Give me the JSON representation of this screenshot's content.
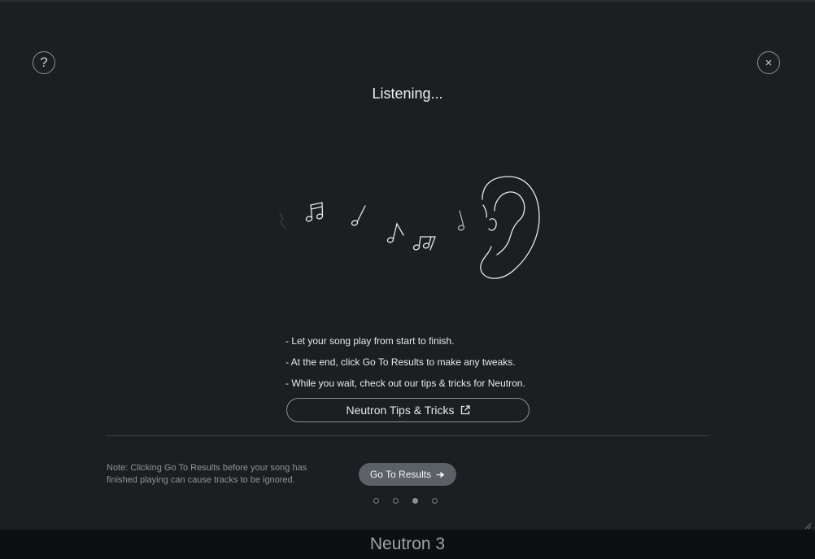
{
  "header": {
    "title": "Listening...",
    "help_icon": "question-mark-icon",
    "close_icon": "close-icon"
  },
  "instructions": [
    "- Let your song play from start to finish.",
    "- At the end, click Go To Results to make any tweaks.",
    "- While you wait, check out our tips & tricks for Neutron."
  ],
  "tips_button": {
    "label": "Neutron Tips & Tricks",
    "icon": "external-link-icon"
  },
  "note": "Note: Clicking Go To Results before your song has finished playing can cause tracks to be ignored.",
  "go_to_results": {
    "label": "Go To Results",
    "icon": "arrow-right-icon"
  },
  "pagination": {
    "total": 4,
    "active_index": 2
  },
  "footer": {
    "product": "Neutron 3"
  },
  "colors": {
    "background": "#1c1f22",
    "footer": "#0e0f10",
    "button": "#5b6167",
    "outline": "#8c9094"
  }
}
